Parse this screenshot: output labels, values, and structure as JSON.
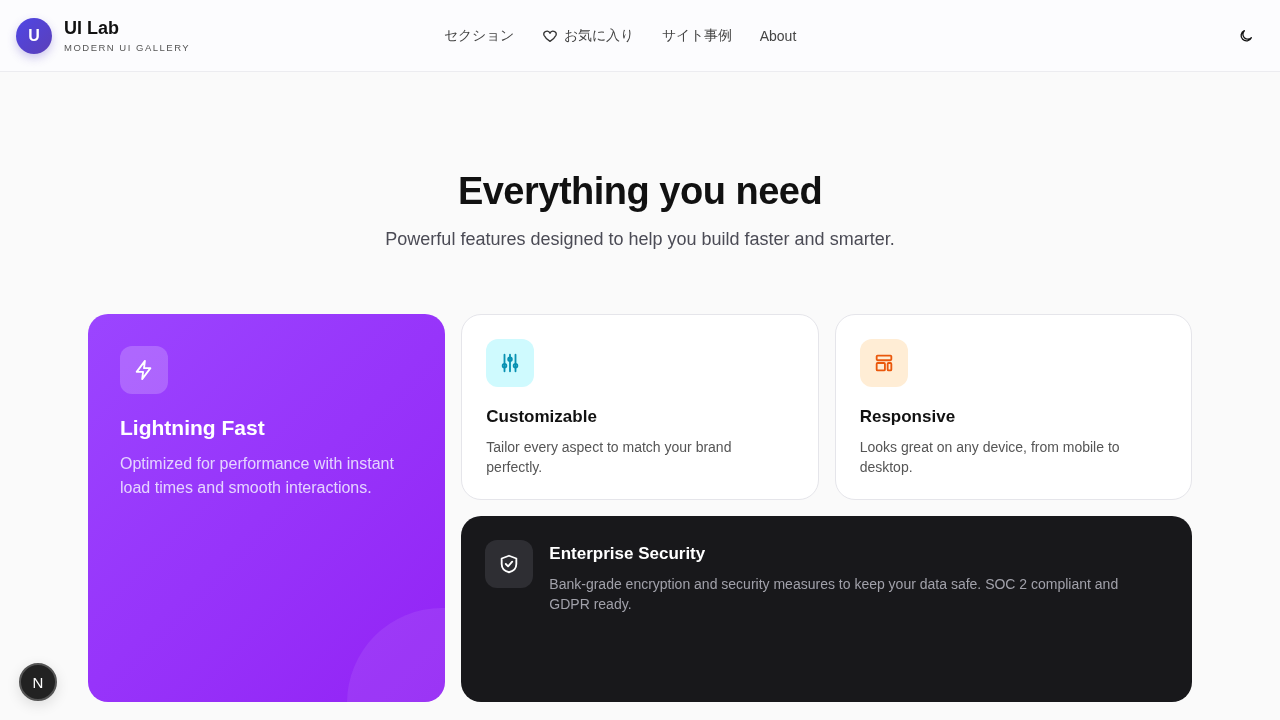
{
  "header": {
    "logo_letter": "U",
    "title": "UI Lab",
    "subtitle": "MODERN UI GALLERY",
    "nav": [
      {
        "label": "セクション",
        "icon": false
      },
      {
        "label": "お気に入り",
        "icon": true
      },
      {
        "label": "サイト事例",
        "icon": false
      },
      {
        "label": "About",
        "icon": false
      }
    ]
  },
  "hero": {
    "title": "Everything you need",
    "subtitle": "Powerful features designed to help you build faster and smarter."
  },
  "features": [
    {
      "kind": "featured",
      "title": "Lightning Fast",
      "text": "Optimized for performance with instant load times and smooth interactions."
    },
    {
      "kind": "plain",
      "title": "Customizable",
      "text": "Tailor every aspect to match your brand perfectly.",
      "color": "#cffafe"
    },
    {
      "kind": "plain",
      "title": "Responsive",
      "text": "Looks great on any device, from mobile to desktop.",
      "color": "#ffedd5"
    },
    {
      "kind": "dark",
      "title": "Enterprise Security",
      "text": "Bank-grade encryption and security measures to keep your data safe. SOC 2 compliant and GDPR ready."
    }
  ],
  "dev_badge": "N"
}
